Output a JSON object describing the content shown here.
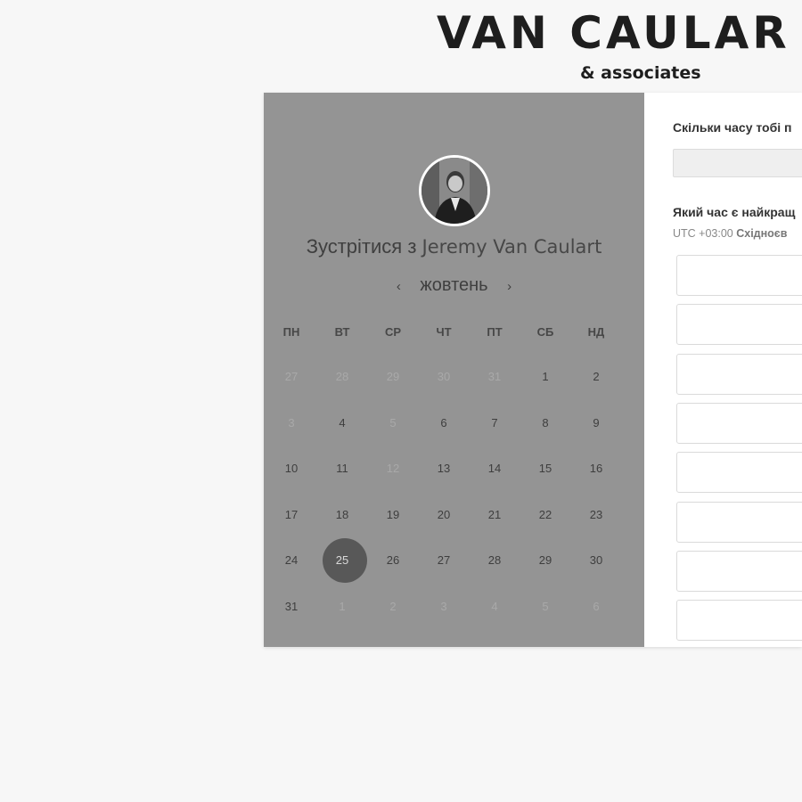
{
  "brand": {
    "name": "VAN CAULAR",
    "tagline": "& associates"
  },
  "calendar": {
    "meet_prefix": "Зустрітися з",
    "host_name": "Jeremy Van Caulart",
    "month": "жовтень",
    "prev_arrow": "‹",
    "next_arrow": "›",
    "weekdays": [
      "ПН",
      "ВТ",
      "СР",
      "ЧТ",
      "ПТ",
      "СБ",
      "НД"
    ],
    "weeks": [
      [
        {
          "d": "27",
          "muted": true
        },
        {
          "d": "28",
          "muted": true
        },
        {
          "d": "29",
          "muted": true
        },
        {
          "d": "30",
          "muted": true
        },
        {
          "d": "31",
          "muted": true
        },
        {
          "d": "1"
        },
        {
          "d": "2"
        }
      ],
      [
        {
          "d": "3",
          "muted": true
        },
        {
          "d": "4"
        },
        {
          "d": "5",
          "muted": true
        },
        {
          "d": "6"
        },
        {
          "d": "7"
        },
        {
          "d": "8"
        },
        {
          "d": "9"
        }
      ],
      [
        {
          "d": "10"
        },
        {
          "d": "11"
        },
        {
          "d": "12",
          "muted": true
        },
        {
          "d": "13"
        },
        {
          "d": "14"
        },
        {
          "d": "15"
        },
        {
          "d": "16"
        }
      ],
      [
        {
          "d": "17"
        },
        {
          "d": "18"
        },
        {
          "d": "19"
        },
        {
          "d": "20"
        },
        {
          "d": "21"
        },
        {
          "d": "22"
        },
        {
          "d": "23"
        }
      ],
      [
        {
          "d": "24"
        },
        {
          "d": "25",
          "selected": true
        },
        {
          "d": "26"
        },
        {
          "d": "27"
        },
        {
          "d": "28"
        },
        {
          "d": "29"
        },
        {
          "d": "30"
        }
      ],
      [
        {
          "d": "31"
        },
        {
          "d": "1",
          "muted": true
        },
        {
          "d": "2",
          "muted": true
        },
        {
          "d": "3",
          "muted": true
        },
        {
          "d": "4",
          "muted": true
        },
        {
          "d": "5",
          "muted": true
        },
        {
          "d": "6",
          "muted": true
        }
      ]
    ],
    "selected_day": "25"
  },
  "booking": {
    "duration_question": "Скільки часу тобі п",
    "time_question": "Який час є найкращ",
    "timezone_prefix": "UTC +03:00",
    "timezone_name": "Східноєв",
    "time_slot_count": 8
  },
  "colors": {
    "left_panel_bg": "#949494",
    "selected_day_bg": "#585858",
    "page_bg": "#f7f7f7"
  }
}
